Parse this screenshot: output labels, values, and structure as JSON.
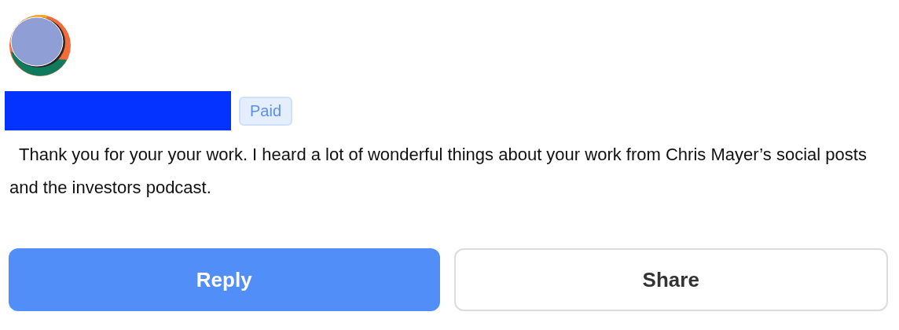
{
  "author": {
    "name_redacted": true,
    "badge": "Paid"
  },
  "message": "Thank you for your your work. I heard a lot of wonderful things about your work from Chris Mayer’s social posts and the investors podcast.",
  "buttons": [
    {
      "label": "Reply",
      "kind": "primary"
    },
    {
      "label": "Share",
      "kind": "secondary"
    }
  ]
}
